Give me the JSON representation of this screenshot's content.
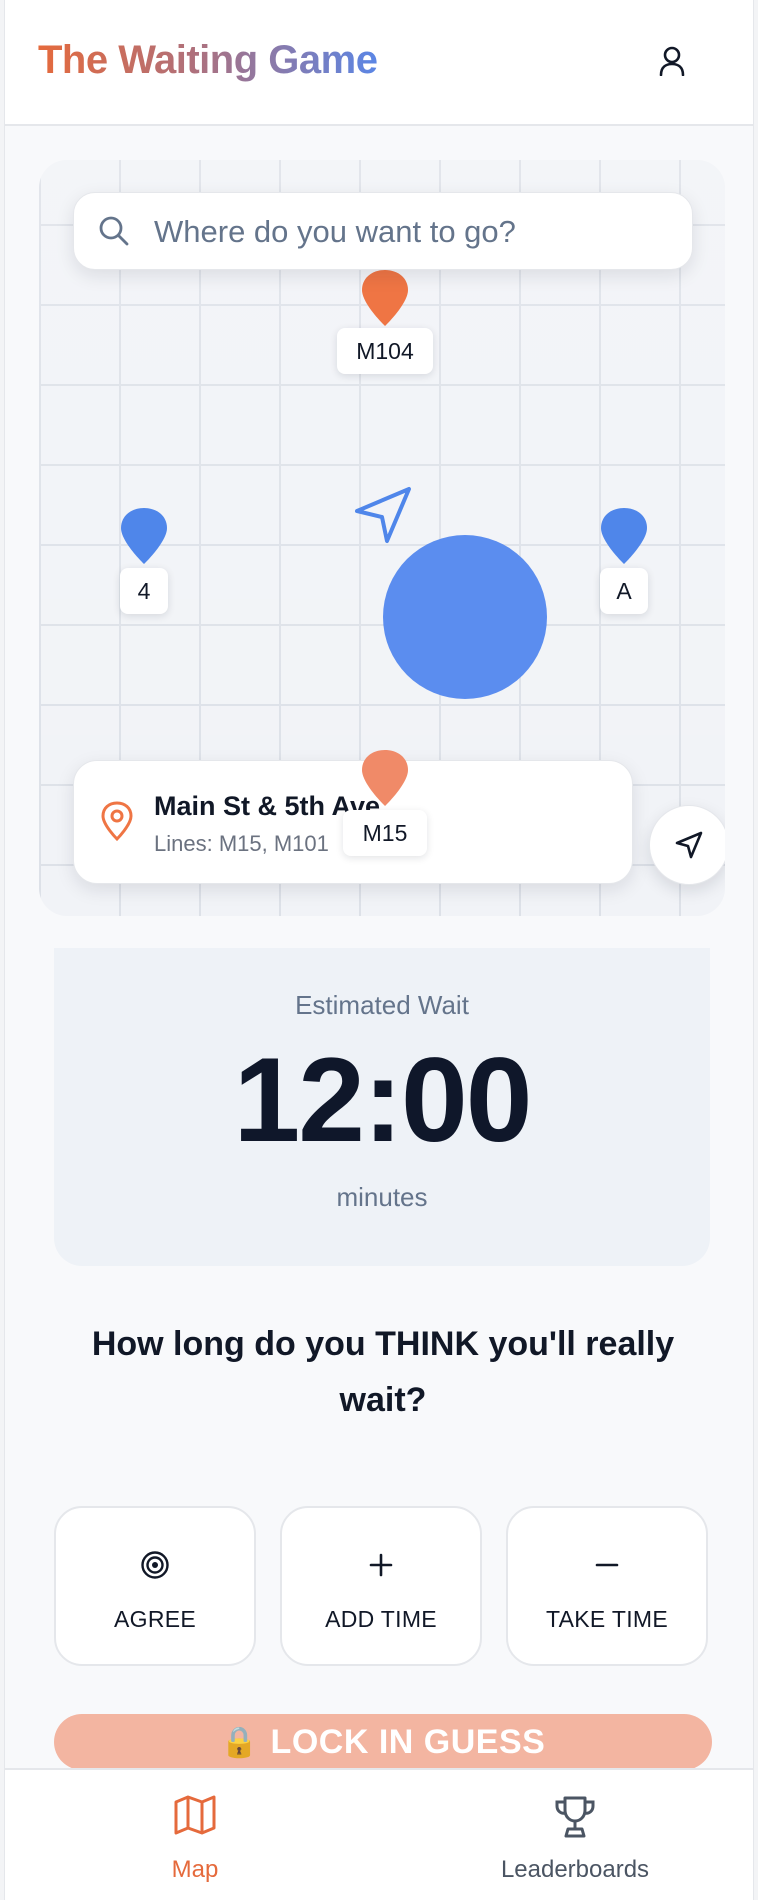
{
  "header": {
    "title": "The Waiting Game",
    "user_icon": "user-icon"
  },
  "map": {
    "search_placeholder": "Where do you want to go?",
    "pins": [
      {
        "label": "M104",
        "color": "#ef7544",
        "kind": "bus"
      },
      {
        "label": "4",
        "color": "#4f86ea",
        "kind": "subway"
      },
      {
        "label": "A",
        "color": "#4f86ea",
        "kind": "subway"
      },
      {
        "label": "M15",
        "color": "#f08a68",
        "kind": "bus"
      }
    ],
    "stop_card": {
      "name": "Main St & 5th Ave",
      "lines": "Lines: M15, M101"
    }
  },
  "estimate": {
    "label": "Estimated Wait",
    "time": "12:00",
    "unit": "minutes"
  },
  "question": "How long do you THINK you'll really wait?",
  "choices": [
    {
      "label": "AGREE",
      "icon": "target-icon"
    },
    {
      "label": "ADD TIME",
      "icon": "plus-icon"
    },
    {
      "label": "TAKE TIME",
      "icon": "minus-icon"
    }
  ],
  "lock_button": {
    "label": "LOCK IN GUESS",
    "icon": "lock-icon"
  },
  "bottom_nav": {
    "items": [
      {
        "label": "Map",
        "icon": "map-icon",
        "active": true
      },
      {
        "label": "Leaderboards",
        "icon": "trophy-icon",
        "active": false
      }
    ]
  },
  "colors": {
    "accent": "#e56a3c",
    "blue": "#5b8def",
    "lock_button_bg": "#f3b5a1"
  }
}
